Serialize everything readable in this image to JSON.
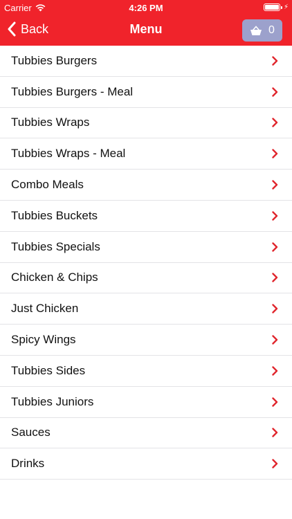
{
  "status_bar": {
    "carrier": "Carrier",
    "time": "4:26 PM",
    "icons": [
      "wifi-icon",
      "battery-icon",
      "charging-bolt-icon"
    ]
  },
  "nav": {
    "back_label": "Back",
    "title": "Menu",
    "cart_count": "0",
    "icons": {
      "back": "chevron-left-icon",
      "cart": "basket-icon"
    }
  },
  "colors": {
    "header": "#f0232b",
    "cart_button": "#9ca1cc",
    "chevron": "#e0262d",
    "divider": "#e3e3e6"
  },
  "menu": {
    "items": [
      {
        "label": "Tubbies Burgers"
      },
      {
        "label": "Tubbies Burgers - Meal"
      },
      {
        "label": "Tubbies Wraps"
      },
      {
        "label": "Tubbies Wraps - Meal"
      },
      {
        "label": "Combo Meals"
      },
      {
        "label": "Tubbies Buckets"
      },
      {
        "label": "Tubbies Specials"
      },
      {
        "label": "Chicken & Chips"
      },
      {
        "label": "Just Chicken"
      },
      {
        "label": "Spicy Wings"
      },
      {
        "label": "Tubbies Sides"
      },
      {
        "label": "Tubbies Juniors"
      },
      {
        "label": "Sauces"
      },
      {
        "label": "Drinks"
      }
    ]
  }
}
